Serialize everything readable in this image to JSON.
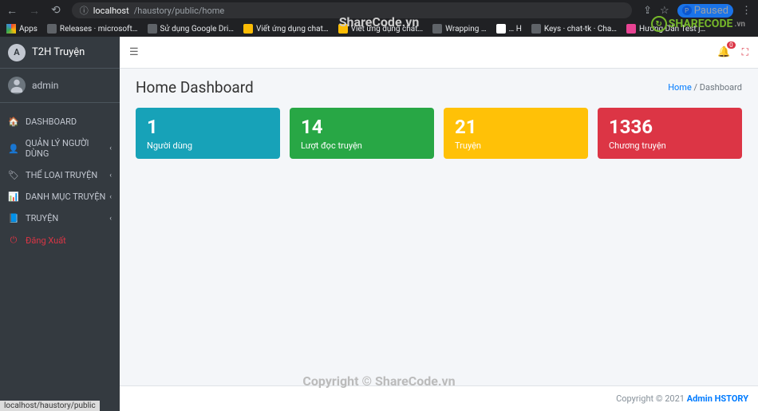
{
  "browser": {
    "url_host": "localhost",
    "url_path": "/haustory/public/home",
    "paused_label": "Paused",
    "paused_initial": "P",
    "status_url": "localhost/haustory/public"
  },
  "bookmarks": [
    {
      "label": "Apps"
    },
    {
      "label": "Releases · microsoft…"
    },
    {
      "label": "Sử dụng Google Dri…"
    },
    {
      "label": "Viết ứng dụng chat…"
    },
    {
      "label": "Viết ứng dụng chat…"
    },
    {
      "label": "Wrapping …"
    },
    {
      "label": "… H"
    },
    {
      "label": "Keys · chat-tk · Cha…"
    },
    {
      "label": "Hướng Dẫn Test j…"
    }
  ],
  "sidebar": {
    "brand": "T2H Truyện",
    "brand_logo": "A",
    "user": "admin",
    "items": [
      {
        "icon": "🏠",
        "label": "DASHBOARD",
        "chev": false
      },
      {
        "icon": "👤",
        "label": "QUẢN LÝ NGƯỜI DÙNG",
        "chev": true
      },
      {
        "icon": "🏷",
        "label": "THỂ LOẠI TRUYỆN",
        "chev": true
      },
      {
        "icon": "📊",
        "label": "DANH MỤC TRUYỆN",
        "chev": true
      },
      {
        "icon": "📘",
        "label": "TRUYỆN",
        "chev": true
      }
    ],
    "logout": {
      "icon": "⏻",
      "label": "Đăng Xuất"
    }
  },
  "topbar": {
    "notif_badge": "0"
  },
  "header": {
    "title": "Home Dashboard",
    "breadcrumb_home": "Home",
    "breadcrumb_sep": " / ",
    "breadcrumb_current": "Dashboard"
  },
  "stats": [
    {
      "value": "1",
      "label": "Người dùng",
      "class": "bg-info"
    },
    {
      "value": "14",
      "label": "Lượt đọc truyện",
      "class": "bg-success"
    },
    {
      "value": "21",
      "label": "Truyện",
      "class": "bg-warning"
    },
    {
      "value": "1336",
      "label": "Chương truyện",
      "class": "bg-danger"
    }
  ],
  "footer": {
    "copyright": "Copyright © 2021 ",
    "brand": "Admin HSTORY"
  },
  "watermark": {
    "top": "ShareCode.vn",
    "bottom": "Copyright © ShareCode.vn",
    "logo_text": "SHARECODE",
    "logo_suffix": ".vn"
  }
}
